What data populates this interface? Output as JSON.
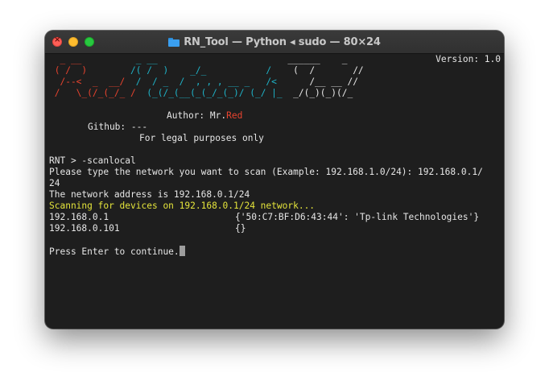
{
  "window": {
    "title": "RN_Tool — Python ◂ sudo — 80×24",
    "close_glyph": "×"
  },
  "banner": {
    "version": "Version: 1.0",
    "rows": [
      {
        "red": "  _ __",
        "cyan": "          _ __           ",
        "white": "             ______    _"
      },
      {
        "red": " ( /  )",
        "cyan": "        /( /  )    _/_           /  ",
        "white": "  (  /       //"
      },
      {
        "red": "  /--<  _  __/  ",
        "cyan": "/  / _  /  , , , __ _   /<  ",
        "white": "    /__ __ //"
      },
      {
        "red": " /   \\_(/_(_/_ /  ",
        "cyan": "(_(/_(__(_(_/_(_)/ (_/ |_ ",
        "white": " _/(_)(_)(/_"
      }
    ],
    "author_label": "Author: Mr.",
    "author_name": "Red",
    "github": "Github: ---",
    "legal": "For legal purposes only"
  },
  "session": {
    "prompt": "RNT > ",
    "command": "-scanlocal",
    "ask_line_1": "Please type the network you want to scan (Example: 192.168.1.0/24): 192.168.0.1/",
    "ask_line_2": "24",
    "network_info": "The network address is 192.168.0.1/24",
    "scanning": "Scanning for devices on 192.168.0.1/24 network...",
    "devices": [
      {
        "ip": "192.168.0.1",
        "info": "{'50:C7:BF:D6:43:44': 'Tp-link Technologies'}"
      },
      {
        "ip": "192.168.0.101",
        "info": "{}"
      }
    ],
    "continue_prompt": "Press Enter to continue."
  }
}
